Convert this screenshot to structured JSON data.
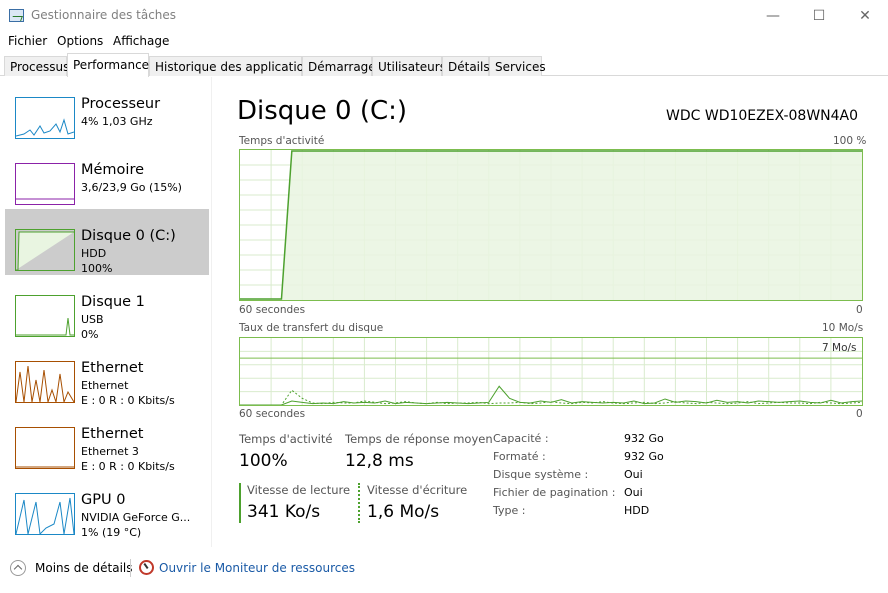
{
  "window": {
    "title": "Gestionnaire des tâches",
    "minimize": "—",
    "maximize": "☐",
    "close": "✕"
  },
  "menu": [
    "Fichier",
    "Options",
    "Affichage"
  ],
  "tabs": [
    "Processus",
    "Performance",
    "Historique des applications",
    "Démarrage",
    "Utilisateurs",
    "Détails",
    "Services"
  ],
  "active_tab": "Performance",
  "sidebar": {
    "items": [
      {
        "title": "Processeur",
        "line1": "4% 1,03 GHz",
        "line2": "",
        "line3": "",
        "color": "#1b88c6",
        "selected": false
      },
      {
        "title": "Mémoire",
        "line1": "3,6/23,9 Go (15%)",
        "line2": "",
        "line3": "",
        "color": "#8b22a8",
        "selected": false
      },
      {
        "title": "Disque 0 (C:)",
        "line1": "HDD",
        "line2": "100%",
        "line3": "",
        "color": "#4da12e",
        "selected": true
      },
      {
        "title": "Disque 1",
        "line1": "USB",
        "line2": "0%",
        "line3": "",
        "color": "#4da12e",
        "selected": false
      },
      {
        "title": "Ethernet",
        "line1": "Ethernet",
        "line2": "E : 0 R : 0 Kbits/s",
        "line3": "",
        "color": "#a74f01",
        "selected": false
      },
      {
        "title": "Ethernet",
        "line1": "Ethernet 3",
        "line2": "E : 0 R : 0 Kbits/s",
        "line3": "",
        "color": "#a74f01",
        "selected": false
      },
      {
        "title": "GPU 0",
        "line1": "NVIDIA GeForce G...",
        "line2": "1% (19 °C)",
        "line3": "",
        "color": "#1b88c6",
        "selected": false
      }
    ]
  },
  "main": {
    "title": "Disque 0 (C:)",
    "model": "WDC WD10EZEX-08WN4A0",
    "activity_chart": {
      "label": "Temps d'activité",
      "max_label": "100 %",
      "x_left": "60 secondes",
      "x_right": "0",
      "color": "#4da12e",
      "fill": "#e9f5e1",
      "values": [
        0,
        0,
        0,
        0,
        0,
        100,
        100,
        100,
        100,
        100,
        100,
        100,
        100,
        100,
        100,
        100,
        100,
        100,
        100,
        100,
        100,
        100,
        100,
        100,
        100,
        100,
        100,
        100,
        100,
        100,
        100,
        100,
        100,
        100,
        100,
        100,
        100,
        100,
        100,
        100,
        100,
        100,
        100,
        100,
        100,
        100,
        100,
        100,
        100,
        100,
        100,
        100,
        100,
        100,
        100,
        100,
        100,
        100,
        100,
        100,
        100
      ]
    },
    "transfer_chart": {
      "label": "Taux de transfert du disque",
      "max_label": "10 Mo/s",
      "ref_label": "7 Mo/s",
      "x_left": "60 secondes",
      "x_right": "0",
      "read_values": [
        0,
        0,
        0,
        0,
        0,
        0.6,
        0.4,
        0.2,
        0.3,
        0.2,
        0.5,
        0.3,
        0.4,
        0.3,
        0.6,
        0.2,
        0.4,
        0.3,
        0.2,
        0.3,
        0.4,
        0.3,
        0.2,
        0.3,
        0.4,
        2.8,
        1.0,
        0.4,
        0.3,
        0.6,
        0.4,
        0.8,
        0.3,
        0.5,
        0.4,
        0.3,
        0.4,
        0.3,
        0.6,
        0.2,
        0.3,
        0.9,
        0.4,
        0.6,
        0.5,
        0.3,
        0.7,
        0.4,
        0.5,
        0.3,
        0.6,
        0.5,
        0.4,
        0.5,
        0.6,
        0.4,
        0.3,
        0.7,
        0.3,
        0.5,
        0.6
      ],
      "write_values": [
        0,
        0,
        0,
        0,
        0,
        2.2,
        1.0,
        0.3,
        0.2,
        0.4,
        0.3,
        0.3,
        0.6,
        0.4,
        0.2,
        0.3,
        0.5,
        0.3,
        0.2,
        0.4,
        0.2,
        0.3,
        0.3,
        0.4,
        0.2,
        0.3,
        0.3,
        0.4,
        0.2,
        0.3,
        0.5,
        0.3,
        0.2,
        0.4,
        0.3,
        0.5,
        0.3,
        0.2,
        0.3,
        0.4,
        0.2,
        0.3,
        0.5,
        0.3,
        0.2,
        0.4,
        0.3,
        0.2,
        0.3,
        0.5,
        0.2,
        0.3,
        0.4,
        0.3,
        0.3,
        0.2,
        0.4,
        0.3,
        0.2,
        0.3,
        0.4
      ],
      "ymax": 10
    },
    "stats": {
      "activity_label": "Temps d'activité",
      "activity_value": "100%",
      "response_label": "Temps de réponse moyen",
      "response_value": "12,8 ms",
      "read_label": "Vitesse de lecture",
      "read_value": "341 Ko/s",
      "write_label": "Vitesse d'écriture",
      "write_value": "1,6 Mo/s"
    },
    "properties": [
      {
        "label": "Capacité :",
        "value": "932 Go"
      },
      {
        "label": "Formaté :",
        "value": "932 Go"
      },
      {
        "label": "Disque système :",
        "value": "Oui"
      },
      {
        "label": "Fichier de pagination :",
        "value": "Oui"
      },
      {
        "label": "Type :",
        "value": "HDD"
      }
    ]
  },
  "footer": {
    "less_details": "Moins de détails",
    "resource_monitor": "Ouvrir le Moniteur de ressources"
  }
}
